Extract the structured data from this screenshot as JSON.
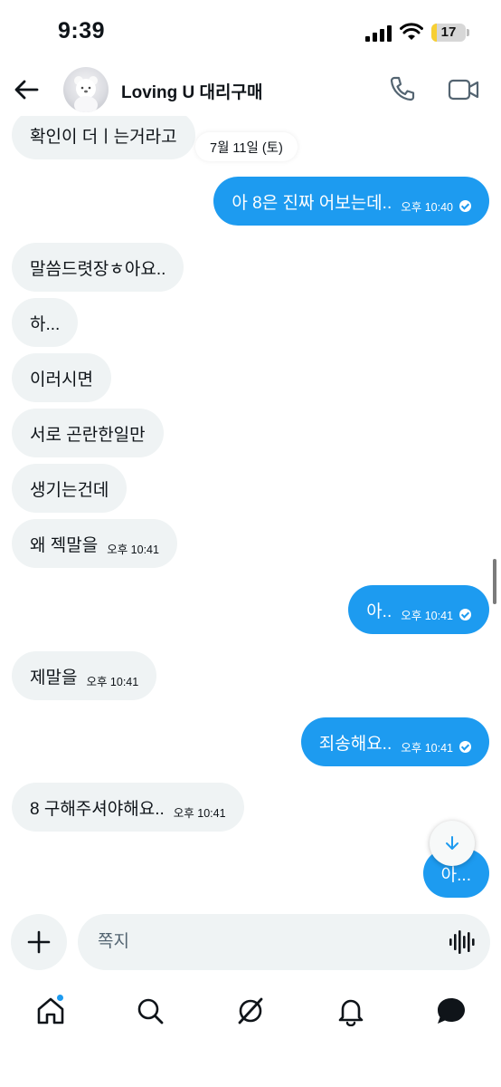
{
  "status_bar": {
    "time": "9:39",
    "battery": "17",
    "battery_level": 0.17
  },
  "header": {
    "contact_name": "Loving U 대리구매"
  },
  "date_separator": "7월 11일 (토)",
  "messages": [
    {
      "side": "in",
      "text": "확인이 더ㅣ는거라고",
      "time": ""
    },
    {
      "side": "out",
      "text": "아 8은 진짜 어보는데..",
      "time": "오후 10:40",
      "read": true
    },
    {
      "side": "in",
      "text": "말씀드렷장ㅎ아요..",
      "time": ""
    },
    {
      "side": "in",
      "text": "하...",
      "time": ""
    },
    {
      "side": "in",
      "text": "이러시면",
      "time": ""
    },
    {
      "side": "in",
      "text": "서로 곤란한일만",
      "time": ""
    },
    {
      "side": "in",
      "text": "생기는건데",
      "time": ""
    },
    {
      "side": "in",
      "text": "왜 젝말을",
      "time": "오후 10:41"
    },
    {
      "side": "out",
      "text": "아..",
      "time": "오후 10:41",
      "read": true
    },
    {
      "side": "in",
      "text": "제말을",
      "time": "오후 10:41"
    },
    {
      "side": "out",
      "text": "죄송해요..",
      "time": "오후 10:41",
      "read": true
    },
    {
      "side": "in",
      "text": "8 구해주셔야해요..",
      "time": "오후 10:41"
    },
    {
      "side": "out",
      "text": "아...",
      "time": ""
    }
  ],
  "composer": {
    "placeholder": "쪽지"
  },
  "nav": {
    "icons": [
      "home-icon",
      "search-icon",
      "grok-icon",
      "bell-icon",
      "messages-icon"
    ],
    "home_has_badge": true
  },
  "colors": {
    "accent": "#1d9bf0",
    "incoming_bubble": "#eff3f4",
    "text": "#0f1419"
  }
}
